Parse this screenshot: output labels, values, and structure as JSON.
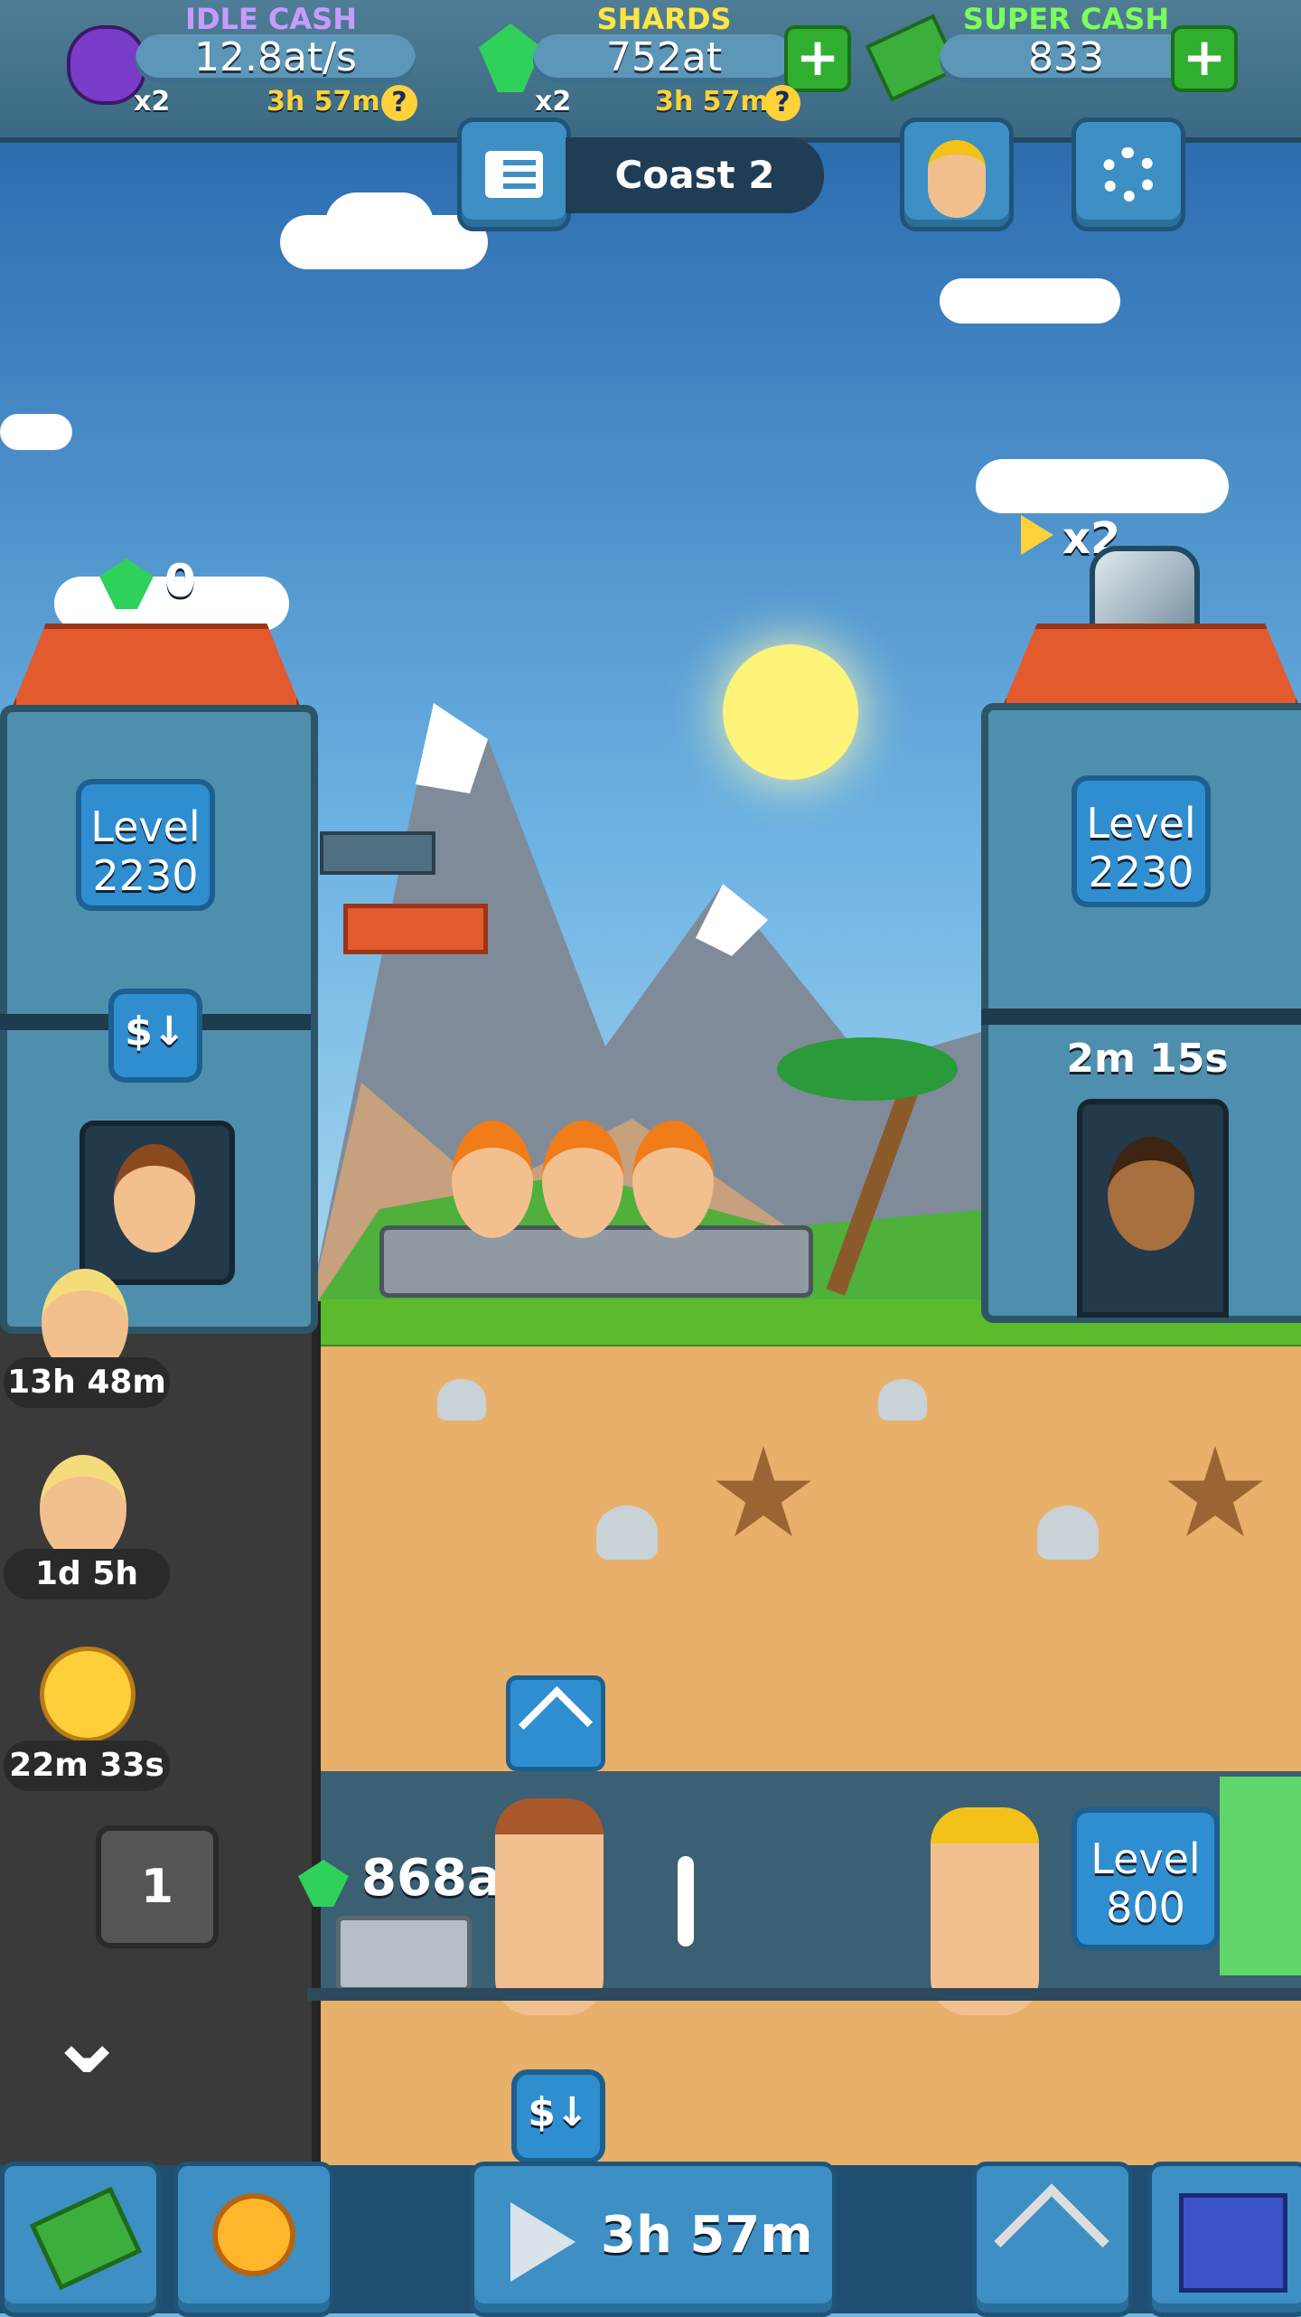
{
  "top_bar": {
    "idle_cash": {
      "label": "IDLE CASH",
      "value": "12.8at/s",
      "multiplier": "x2",
      "timer": "3h 57m"
    },
    "shards": {
      "label": "SHARDS",
      "value": "752at",
      "multiplier": "x2",
      "timer": "3h 57m"
    },
    "super_cash": {
      "label": "SUPER CASH",
      "value": "833"
    },
    "help_symbol": "?",
    "plus_symbol": "+"
  },
  "header": {
    "mine_name": "Coast 2"
  },
  "warehouse": {
    "gem_count": "0",
    "level_label": "Level",
    "level_value": "2230",
    "dollar_symbol": "$↓"
  },
  "market": {
    "boost_label": "x2",
    "level_label": "Level",
    "level_value": "2230",
    "timer": "2m 15s"
  },
  "boosts": [
    {
      "timer": "13h 48m"
    },
    {
      "timer": "1d 5h"
    },
    {
      "timer": "22m 33s"
    }
  ],
  "elevator": {
    "floor": "1",
    "chevron": "⌄"
  },
  "shaft1": {
    "stock": "868ak",
    "level_label": "Level",
    "level_value": "800",
    "dollar_symbol": "$↓"
  },
  "bottom_bar": {
    "boost_timer": "3h 57m"
  },
  "colors": {
    "accent_gold": "#ffd23a",
    "label_purple": "#c79bff",
    "label_yellow": "#ffe640",
    "label_green": "#7dff59"
  }
}
